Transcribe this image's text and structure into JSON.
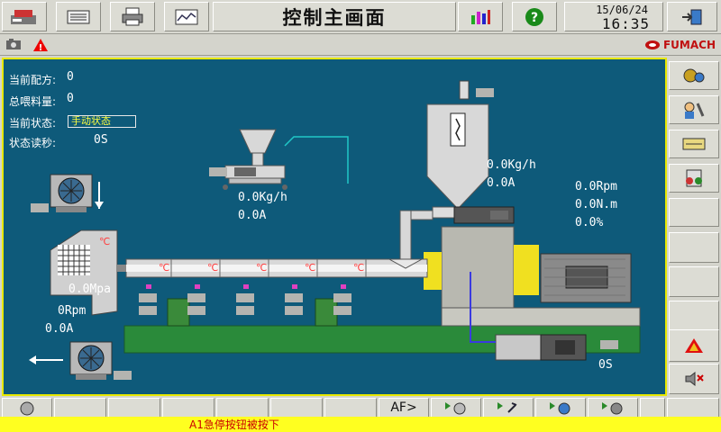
{
  "header": {
    "title": "控制主画面",
    "date": "15/06/24",
    "time": "16:35"
  },
  "brand": {
    "name": "FUMACH"
  },
  "status_panel": {
    "recipe_label": "当前配方:",
    "recipe_value": "0",
    "total_feed_label": "总喂料量:",
    "total_feed_value": "0",
    "state_label": "当前状态:",
    "state_value": "手动状态",
    "countdown_label": "状态读秒:",
    "countdown_value": "0S"
  },
  "readings": {
    "side_feeder_rate": "0.0Kg/h",
    "side_feeder_current": "0.0A",
    "main_feeder_rate": "0.0Kg/h",
    "main_feeder_current": "0.0A",
    "main_motor_speed": "0.0Rpm",
    "main_motor_torque": "0.0N.m",
    "main_motor_load": "0.0%",
    "melt_pressure": "0.0Mpa",
    "pelletizer_speed": "0Rpm",
    "pelletizer_current": "0.0A",
    "pump_time": "0S",
    "die_temp_unit": "℃",
    "zone_temp_units": [
      "℃",
      "℃",
      "℃",
      "℃",
      "℃"
    ]
  },
  "bottom": {
    "af_button": "AF>",
    "alarm_message": "A1急停按钮被按下"
  },
  "icons": {
    "toolbar": [
      "printer-stack-icon",
      "keyboard-icon",
      "printer-icon",
      "trend-chart-icon",
      "bar-chart-icon",
      "help-icon",
      "exit-door-icon"
    ],
    "right": [
      "gears-icon",
      "tools-icon",
      "network-icon",
      "recipe-icon",
      "alarm-warning-icon",
      "mute-speaker-icon"
    ]
  },
  "colors": {
    "panel_bg": "#0e5a7a",
    "accent_yellow": "#e8e800",
    "alarm_text": "#cc0000",
    "machine_green": "#2a8a3a"
  }
}
